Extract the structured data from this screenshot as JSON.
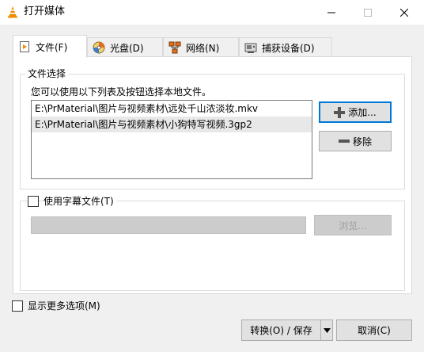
{
  "window": {
    "title": "打开媒体",
    "colors": {
      "accent": "#0078d7",
      "vlc_orange": "#f28c00"
    }
  },
  "tabs": [
    {
      "label": "文件(F)",
      "icon": "file-icon",
      "active": true
    },
    {
      "label": "光盘(D)",
      "icon": "disc-icon",
      "active": false
    },
    {
      "label": "网络(N)",
      "icon": "network-icon",
      "active": false
    },
    {
      "label": "捕获设备(D)",
      "icon": "capture-device-icon",
      "active": false
    }
  ],
  "file_selection": {
    "group_label": "文件选择",
    "hint": "您可以使用以下列表及按钮选择本地文件。",
    "files": [
      "E:\\PrMaterial\\图片与视频素材\\远处千山浓淡妆.mkv",
      "E:\\PrMaterial\\图片与视频素材\\小狗特写视频.3gp2"
    ],
    "add_label": "添加...",
    "remove_label": "移除"
  },
  "subtitle": {
    "checkbox_label": "使用字幕文件(T)",
    "checked": false,
    "path_value": "",
    "browse_label": "浏览..."
  },
  "footer": {
    "more_options_label": "显示更多选项(M)",
    "more_options_checked": false,
    "convert_label": "转换(O) / 保存",
    "cancel_label": "取消(C)"
  }
}
